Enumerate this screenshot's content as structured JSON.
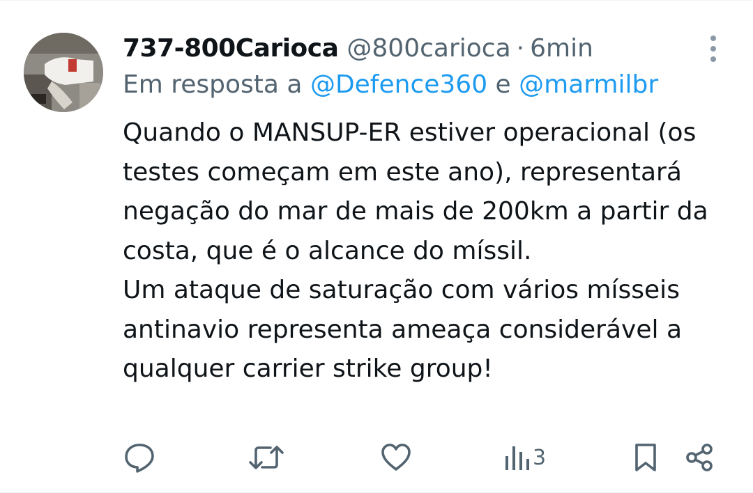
{
  "author": {
    "display_name": "737-800Carioca",
    "handle": "@800carioca",
    "separator": "·",
    "time": "6min"
  },
  "reply_context": {
    "prefix": "Em resposta a ",
    "mention_1": "@Defence360",
    "conjunction": " e ",
    "mention_2": "@marmilbr"
  },
  "body": {
    "paragraph_1": "Quando o MANSUP-ER estiver operacional (os testes começam em este ano), representará negação do mar de mais de 200km a partir da costa, que é o alcance do míssil.",
    "paragraph_2": "Um ataque de saturação com vários mísseis antinavio representa ameaça considerável a qualquer carrier strike group!"
  },
  "actions": {
    "views_count": "3"
  },
  "icons": {
    "reply": "reply-icon",
    "retweet": "retweet-icon",
    "like": "heart-icon",
    "views": "views-icon",
    "bookmark": "bookmark-icon",
    "share": "share-icon",
    "more": "more-vertical-icon"
  },
  "colors": {
    "text": "#0f1419",
    "secondary": "#536471",
    "mention": "#1d9bf0"
  }
}
